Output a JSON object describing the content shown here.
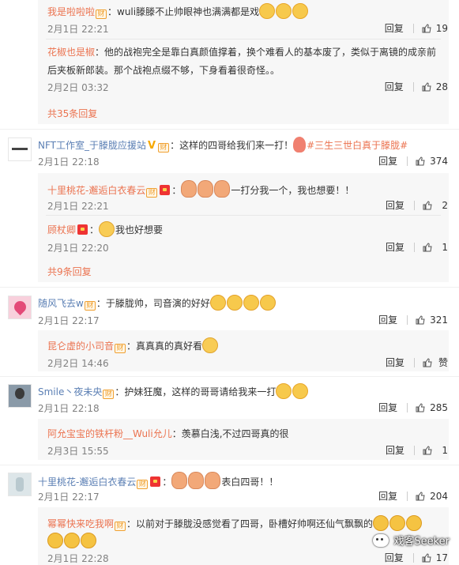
{
  "thread1": {
    "reply1": {
      "name": "我是啦啦啦",
      "text": "：wuli滕滕不止帅眼神也满满都是戏",
      "time": "2月1日 22:21",
      "reply_label": "回复",
      "likes": "19"
    },
    "reply2": {
      "name": "花椒也是椒",
      "text_line1": "：他的战袍完全是靠白真颜值撑着，换个难看人的基本废了，类似于离镜的成亲前",
      "text_line2": "后夹板新郎装。那个战袍点缀不够，下身看着很奇怪。。",
      "time": "2月2日 03:32",
      "reply_label": "回复",
      "likes": "28"
    },
    "more": "共35条回复"
  },
  "comment1": {
    "name": "NFT工作室_于滕胧应援站",
    "text": "：这样的四哥给我们来一打！",
    "topic": "#三生三世白真于滕胧#",
    "time": "2月1日 22:18",
    "reply_label": "回复",
    "likes": "374",
    "reply1": {
      "name": "十里桃花-邂逅白衣春云",
      "text": "一打分我一个，我也想要！！",
      "time": "2月1日 22:21",
      "reply_label": "回复",
      "likes": "2"
    },
    "reply2": {
      "name": "顾杖卿",
      "text": "我也好想要",
      "time": "2月1日 22:20",
      "reply_label": "回复",
      "likes": "1"
    },
    "more": "共9条回复"
  },
  "comment2": {
    "name": "随风飞去w",
    "text": "：于滕胧帅，司音演的好好",
    "time": "2月1日 22:17",
    "reply_label": "回复",
    "likes": "321",
    "reply1": {
      "name": "昆仑虚的小司音",
      "text": "：真真真的真好看",
      "time": "2月2日 14:46",
      "reply_label": "回复",
      "likes": "赞"
    }
  },
  "comment3": {
    "name": "Smile丶夜未央",
    "text": "：护妹狂魔，这样的哥哥请给我来一打",
    "time": "2月1日 22:18",
    "reply_label": "回复",
    "likes": "285",
    "reply1": {
      "name": "阿允宝宝的铁杆粉__Wuli允儿",
      "text": "：羡慕白浅,不过四哥真的很",
      "time": "2月3日 15:55",
      "reply_label": "回复",
      "likes": "1"
    }
  },
  "comment4": {
    "name": "十里桃花-邂逅白衣春云",
    "text": "表白四哥！！",
    "time": "2月1日 22:17",
    "reply_label": "回复",
    "likes": "204",
    "reply1": {
      "name": "幂幂快来吃我啊",
      "text": "：以前对于滕胧没感觉看了四哥，卧槽好帅啊还仙气飘飘的",
      "time": "2月1日 22:28",
      "reply_label": "回复",
      "likes": "17"
    }
  },
  "watermark": "戏客Seeker",
  "badge_text": "财"
}
